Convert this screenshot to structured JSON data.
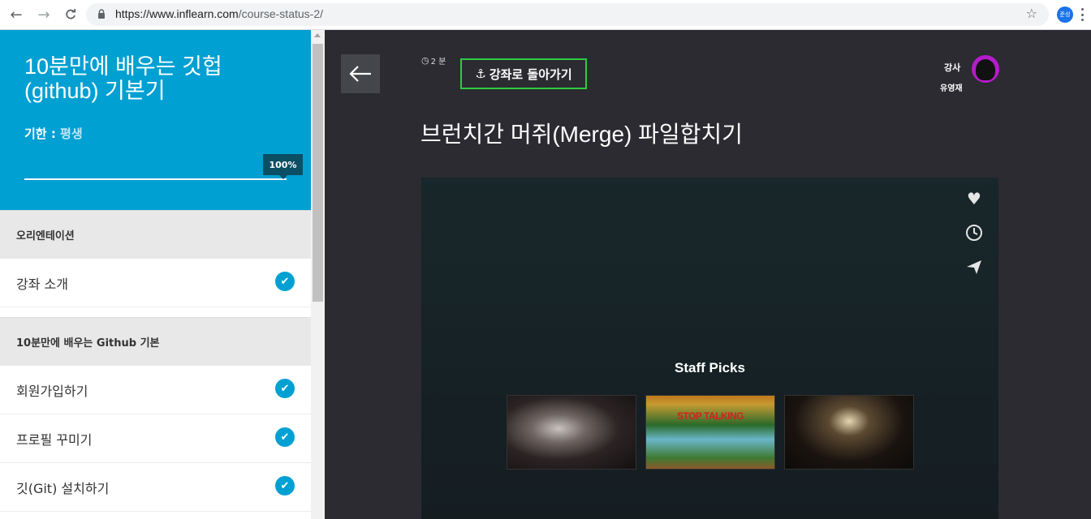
{
  "browser": {
    "url_host": "https://www.inflearn.com",
    "url_path": "/course-status-2/",
    "profile_label": "준성"
  },
  "sidebar": {
    "course_title": "10분만에 배우는 깃헙 (github) 기본기",
    "period_label": "기한 : ",
    "period_value": "평생",
    "progress_label": "100%",
    "progress_value": 1.0,
    "sections": [
      {
        "title": "오리엔테이션",
        "lessons": [
          {
            "title": "강좌 소개",
            "completed": true
          }
        ]
      },
      {
        "title": "10분만에 배우는 Github 기본",
        "lessons": [
          {
            "title": "회원가입하기",
            "completed": true
          },
          {
            "title": "프로필 꾸미기",
            "completed": true
          },
          {
            "title": "깃(Git) 설치하기",
            "completed": true
          }
        ]
      }
    ]
  },
  "main": {
    "duration": "2 분",
    "return_button": "강좌로 돌아가기",
    "instructor_label": "강사",
    "instructor_name": "유영재",
    "lesson_title": "브런치간 머쥐(Merge) 파일합치기",
    "video": {
      "staff_picks_title": "Staff Picks",
      "thumbnail_caption": "STOP TALKING",
      "actions": [
        "heart-icon",
        "clock-icon",
        "send-icon"
      ]
    }
  },
  "colors": {
    "accent": "#00a0d2",
    "dark_bg": "#2b2b31",
    "return_border": "#2ecc40"
  }
}
